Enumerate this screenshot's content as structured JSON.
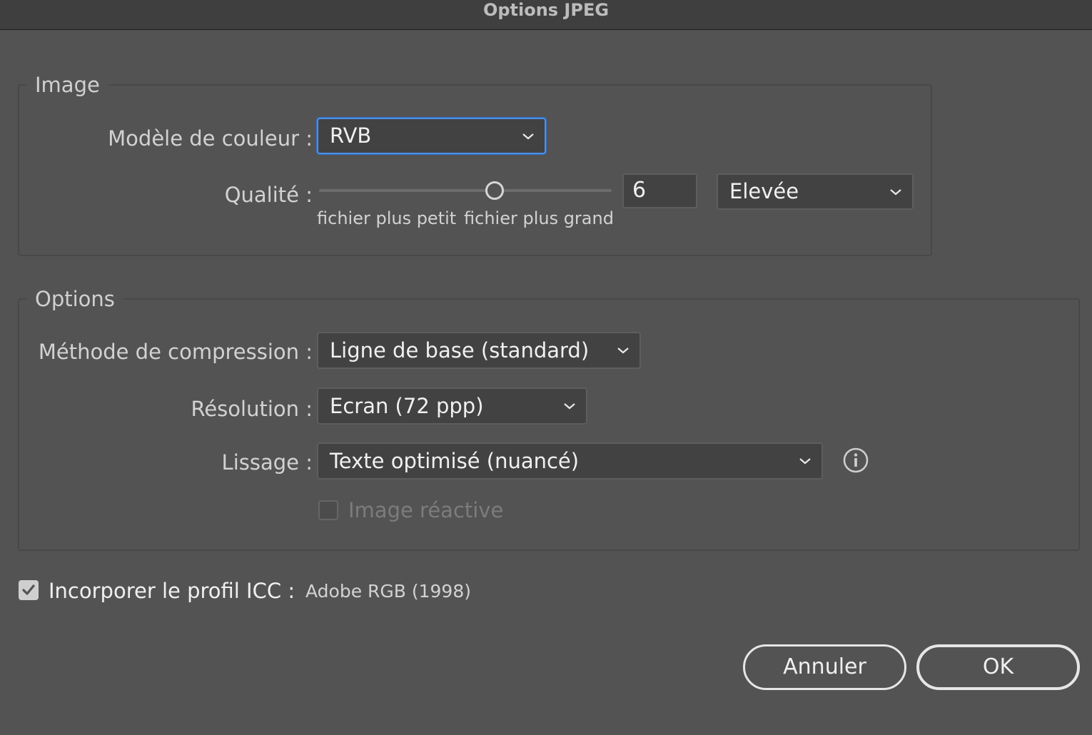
{
  "window": {
    "title": "Options JPEG"
  },
  "image_group": {
    "title": "Image",
    "color_model": {
      "label": "Modèle de couleur :",
      "value": "RVB"
    },
    "quality": {
      "label": "Qualité :",
      "value": "6",
      "level_fraction": 0.6,
      "preset": "Elevée",
      "min_label": "fichier plus petit",
      "max_label": "fichier plus grand"
    }
  },
  "options_group": {
    "title": "Options",
    "compression": {
      "label": "Méthode de compression :",
      "value": "Ligne de base (standard)"
    },
    "resolution": {
      "label": "Résolution :",
      "value": "Ecran (72 ppp)"
    },
    "antialiasing": {
      "label": "Lissage :",
      "value": "Texte optimisé (nuancé)",
      "info_icon": "info-icon"
    },
    "image_map": {
      "label": "Image réactive",
      "checked": false,
      "enabled": false
    }
  },
  "icc": {
    "label": "Incorporer le profil ICC :",
    "profile": "Adobe RGB (1998)",
    "checked": true
  },
  "buttons": {
    "cancel": "Annuler",
    "ok": "OK"
  },
  "colors": {
    "background": "#535353",
    "focus_ring": "#4d8fe6",
    "field_bg": "#424242"
  }
}
